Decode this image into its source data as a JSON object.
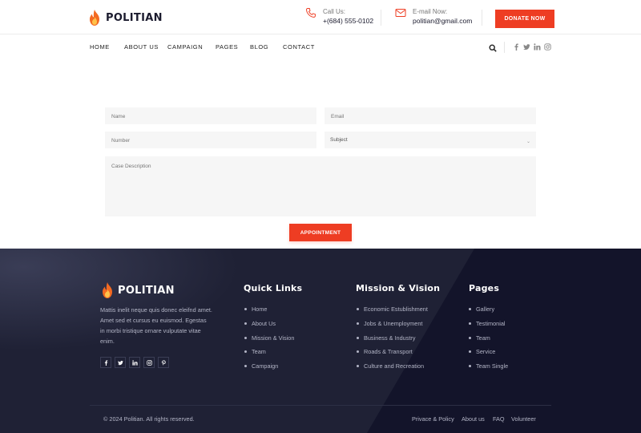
{
  "brand": {
    "name": "POLITIAN",
    "accent": "#ee3d23",
    "footer_bg": "#15172a"
  },
  "header": {
    "call": {
      "icon": "phone-icon",
      "label": "Call Us:",
      "value": "+(684) 555-0102"
    },
    "mail": {
      "icon": "mail-icon",
      "label": "E-mail Now:",
      "value": "politian@gmail.com"
    },
    "donate_label": "DONATE NOW"
  },
  "nav": {
    "items": [
      {
        "label": "HOME"
      },
      {
        "label": "ABOUT US"
      },
      {
        "label": "CAMPAIGN"
      },
      {
        "label": "PAGES"
      },
      {
        "label": "BLOG"
      },
      {
        "label": "CONTACT"
      }
    ],
    "search_icon": "search-icon",
    "social_icons": [
      "facebook-icon",
      "twitter-icon",
      "linkedin-icon",
      "instagram-icon"
    ]
  },
  "form": {
    "name_placeholder": "Name",
    "email_placeholder": "Email",
    "number_placeholder": "Number",
    "subject_placeholder": "Subject",
    "description_placeholder": "Case Description",
    "submit_label": "APPOINTMENT"
  },
  "footer": {
    "brand": "POLITIAN",
    "about": "Mattis inelit neque quis donec eleifnd amet. Amet sed et cursus eu euismod. Egestas in morbi tristique ornare vulputate vitae enim.",
    "social_icons": [
      "facebook-icon",
      "twitter-icon",
      "linkedin-icon",
      "instagram-icon",
      "pinterest-icon"
    ],
    "quick_links": {
      "title": "Quick Links",
      "items": [
        "Home",
        "About Us",
        "Mission & Vision",
        "Team",
        "Campaign"
      ]
    },
    "mission": {
      "title": "Mission & Vision",
      "items": [
        "Economic Estublishment",
        "Jobs & Unemployment",
        "Business & Industry",
        "Roads & Transport",
        "Culture and Recreation"
      ]
    },
    "pages": {
      "title": "Pages",
      "items": [
        "Gallery",
        "Testimonial",
        "Team",
        "Service",
        "Team Single"
      ]
    },
    "copyright": "© 2024 Politian. All rights reserved.",
    "bottom_links": [
      "Privace & Policy",
      "About us",
      "FAQ",
      "Volunteer"
    ]
  }
}
